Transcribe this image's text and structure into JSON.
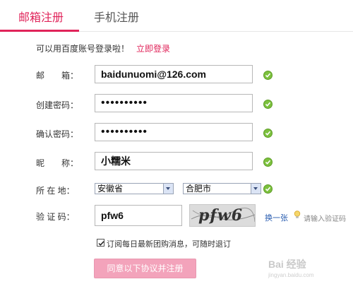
{
  "tabs": [
    {
      "label": "邮箱注册",
      "active": true
    },
    {
      "label": "手机注册",
      "active": false
    }
  ],
  "hint": {
    "text": "可以用百度账号登录啦！",
    "link": "立即登录"
  },
  "form": {
    "email": {
      "label": "邮　　箱：",
      "value": "baidunuomi@126.com"
    },
    "password": {
      "label": "创建密码：",
      "value": "••••••••••"
    },
    "confirm": {
      "label": "确认密码：",
      "value": "••••••••••"
    },
    "nickname": {
      "label": "昵　　称：",
      "value": "小糯米"
    },
    "location": {
      "label": "所 在 地：",
      "province": "安徽省",
      "city": "合肥市"
    },
    "captcha": {
      "label": "验 证 码：",
      "value": "pfw6",
      "image_text": "pfw6",
      "refresh": "换一张",
      "hint": "请输入验证码"
    }
  },
  "agree": {
    "text": "订阅每日最新团购消息，可随时退订",
    "checked": true
  },
  "submit_label": "同意以下协议并注册",
  "watermark": {
    "brand": "Bai 经验",
    "sub": "jingyan.baidu.com"
  },
  "colors": {
    "accent": "#e0245a",
    "valid": "#7cc13d",
    "button": "#f3a3bb"
  }
}
